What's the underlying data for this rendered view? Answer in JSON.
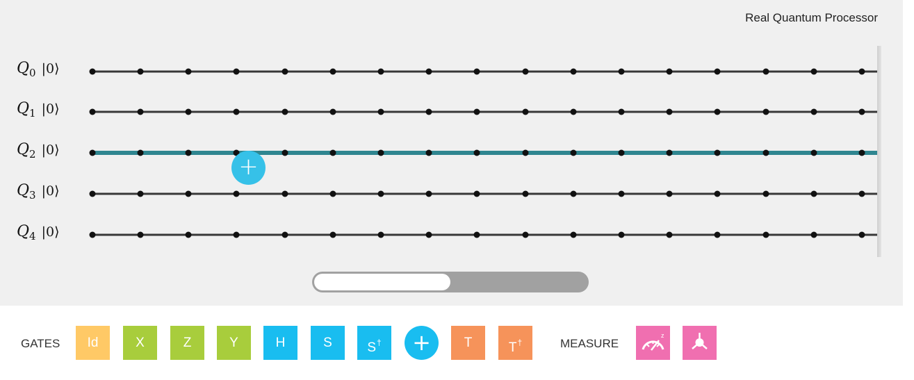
{
  "header": {
    "processor_label": "Real Quantum Processor"
  },
  "qubits": [
    {
      "name": "Q",
      "index": "0",
      "state": "|0⟩",
      "selected": false
    },
    {
      "name": "Q",
      "index": "1",
      "state": "|0⟩",
      "selected": false
    },
    {
      "name": "Q",
      "index": "2",
      "state": "|0⟩",
      "selected": true
    },
    {
      "name": "Q",
      "index": "3",
      "state": "|0⟩",
      "selected": false
    },
    {
      "name": "Q",
      "index": "4",
      "state": "|0⟩",
      "selected": false
    }
  ],
  "add_button": {
    "symbol": "+"
  },
  "scroll": {
    "position_fraction": 0.5
  },
  "palette": {
    "gates_label": "GATES",
    "measure_label": "MEASURE",
    "gates": [
      {
        "label": "Id",
        "color": "#ffc966"
      },
      {
        "label": "X",
        "color": "#a8cd3c"
      },
      {
        "label": "Z",
        "color": "#a8cd3c"
      },
      {
        "label": "Y",
        "color": "#a8cd3c"
      },
      {
        "label": "H",
        "color": "#19bdf0"
      },
      {
        "label": "S",
        "color": "#19bdf0"
      },
      {
        "label": "S",
        "sup": "†",
        "color": "#19bdf0"
      },
      {
        "label": "+",
        "color": "#19bdf0",
        "shape": "circle"
      },
      {
        "label": "T",
        "color": "#f6935a"
      },
      {
        "label": "T",
        "sup": "†",
        "color": "#f6935a"
      }
    ],
    "measure": [
      {
        "icon": "measure-z-icon",
        "sup": "z",
        "color": "#f06fb0"
      },
      {
        "icon": "bloch-measure-icon",
        "color": "#f06fb0"
      }
    ]
  },
  "colors": {
    "wire": "#383838",
    "wire_selected": "#2f8690",
    "background": "#f0f0f0"
  }
}
